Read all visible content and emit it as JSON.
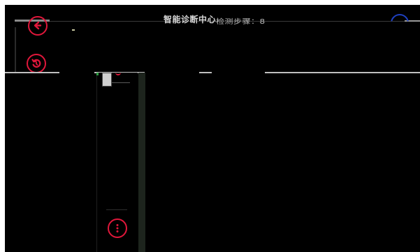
{
  "header": {
    "title": "智能诊断中心",
    "subtitle": "检测步骤：8"
  },
  "icons": {
    "back": "back-arrow-icon",
    "refresh": "refresh-icon",
    "more": "more-vertical-icon",
    "help": "help-icon"
  },
  "colors": {
    "accent": "#e0173b",
    "help": "#1e3fbf",
    "background": "#000000"
  }
}
